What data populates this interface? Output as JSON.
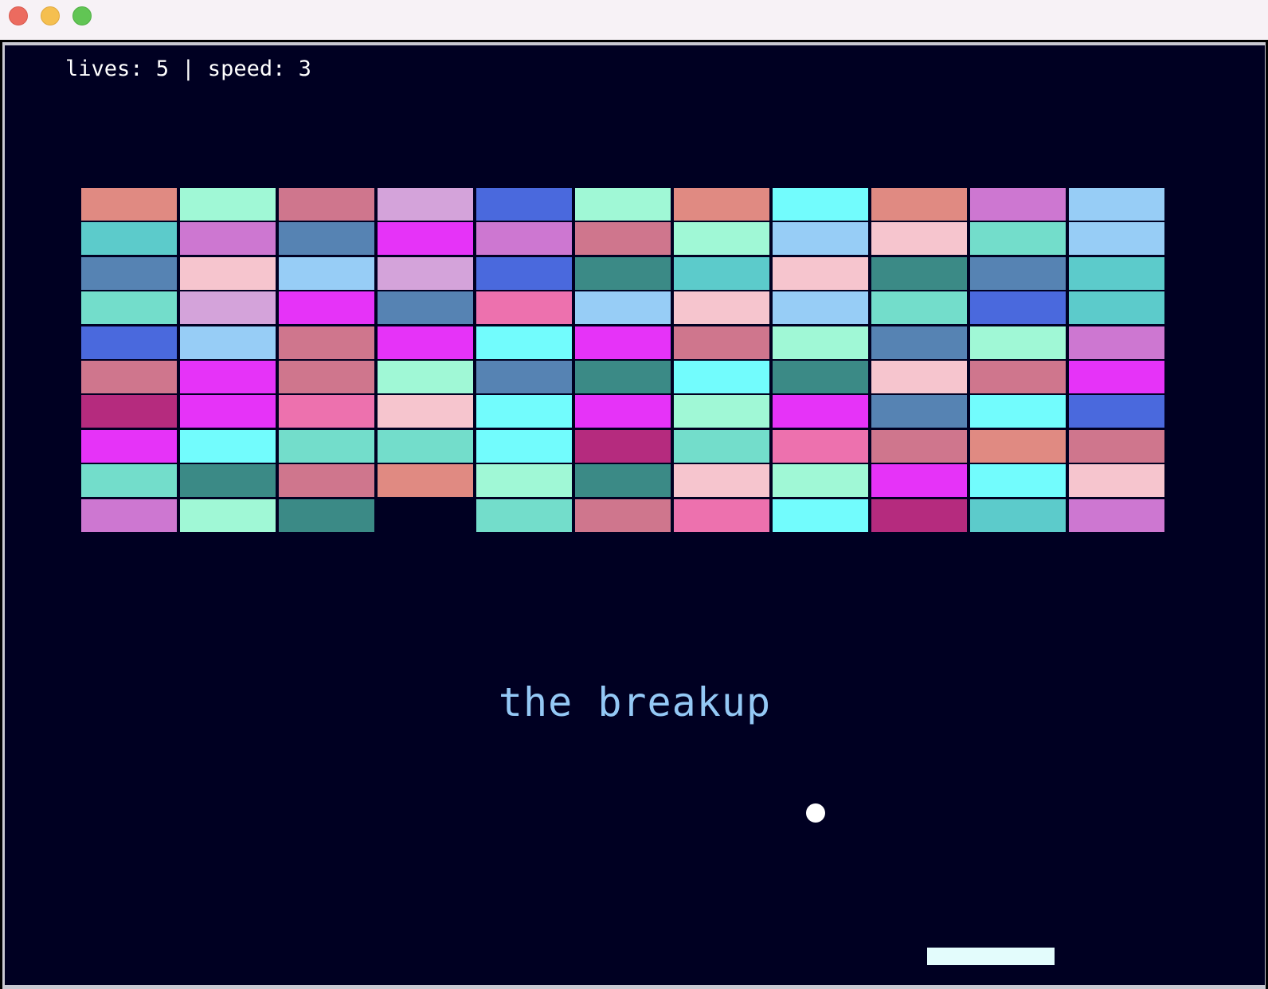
{
  "window": {
    "controls": [
      "close",
      "minimize",
      "maximize"
    ]
  },
  "hud": {
    "status_text": "lives: 5 | speed: 3",
    "lives": 5,
    "speed": 3
  },
  "title": "the breakup",
  "palette": {
    "background": "#000022",
    "title": "#94c8f5",
    "ball": "#ffffff",
    "paddle": "#e3fcfc"
  },
  "bricks": {
    "rows": 10,
    "cols": 11,
    "colors": [
      [
        "#e08a82",
        "#a0f8d6",
        "#cf768d",
        "#d4a3da",
        "#4a69dd",
        "#a0f8d6",
        "#e08a82",
        "#72fcfd",
        "#e08a82",
        "#cd77d1",
        "#97cdf6"
      ],
      [
        "#5ccbcb",
        "#cd77d1",
        "#5683b3",
        "#e633f8",
        "#cd77d1",
        "#cf768d",
        "#a0f8d6",
        "#97cdf6",
        "#f6c5ce",
        "#73ddcb",
        "#97cdf6"
      ],
      [
        "#5683b3",
        "#f6c5ce",
        "#97cdf6",
        "#d4a3da",
        "#4a69dd",
        "#3b8a86",
        "#5ccbcb",
        "#f6c5ce",
        "#3b8a86",
        "#5683b3",
        "#5ccbcb"
      ],
      [
        "#73ddcb",
        "#d4a3da",
        "#e633f8",
        "#5683b3",
        "#ed71ae",
        "#97cdf6",
        "#f6c5ce",
        "#97cdf6",
        "#73ddcb",
        "#4a69dd",
        "#5ccbcb"
      ],
      [
        "#4a69dd",
        "#97cdf6",
        "#cf768d",
        "#e633f8",
        "#72fcfd",
        "#e633f8",
        "#cf768d",
        "#a0f8d6",
        "#5683b3",
        "#a0f8d6",
        "#cd77d1"
      ],
      [
        "#cf768d",
        "#e633f8",
        "#cf768d",
        "#a0f8d6",
        "#5683b3",
        "#3b8a86",
        "#72fcfd",
        "#3b8a86",
        "#f6c5ce",
        "#cf768d",
        "#e633f8"
      ],
      [
        "#b52b7e",
        "#e633f8",
        "#ed71ae",
        "#f6c5ce",
        "#72fcfd",
        "#e633f8",
        "#a0f8d6",
        "#e633f8",
        "#5683b3",
        "#72fcfd",
        "#4a69dd"
      ],
      [
        "#e633f8",
        "#72fcfd",
        "#73ddcb",
        "#73ddcb",
        "#72fcfd",
        "#b52b7e",
        "#73ddcb",
        "#ed71ae",
        "#cf768d",
        "#e08a82",
        "#cf768d"
      ],
      [
        "#73ddcb",
        "#3b8a86",
        "#cf768d",
        "#e08a82",
        "#a0f8d6",
        "#3b8a86",
        "#f6c5ce",
        "#a0f8d6",
        "#e633f8",
        "#72fcfd",
        "#f6c5ce"
      ],
      [
        "#cd77d1",
        "#a0f8d6",
        "#3b8a86",
        null,
        "#73ddcb",
        "#cf768d",
        "#ed71ae",
        "#72fcfd",
        "#b52b7e",
        "#5ccbcb",
        "#cd77d1"
      ]
    ]
  }
}
